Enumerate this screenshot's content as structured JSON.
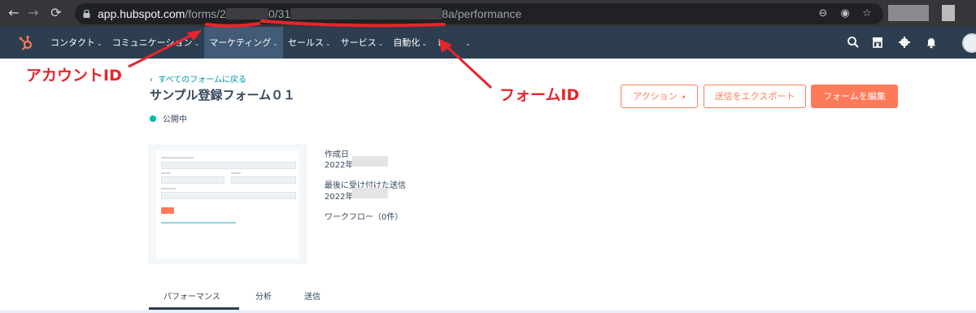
{
  "browser": {
    "url_host": "app.hubspot.com",
    "url_path_1": "/forms/2",
    "url_path_2": "0/31",
    "url_path_3": "8a/performance"
  },
  "nav": {
    "items": [
      {
        "label": "コンタクト"
      },
      {
        "label": "コミュニケーション"
      },
      {
        "label": "マーケティング"
      },
      {
        "label": "セールス"
      },
      {
        "label": "サービス"
      },
      {
        "label": "自動化"
      },
      {
        "label": "レ"
      }
    ]
  },
  "page": {
    "back_link": "すべてのフォームに戻る",
    "title": "サンプル登録フォーム０１",
    "status": "公開中",
    "actions_button": "アクション",
    "export_button": "送信をエクスポート",
    "edit_button": "フォームを編集"
  },
  "meta": {
    "created_label": "作成日",
    "created_value": "2022年",
    "last_submission_label": "最後に受け付けた送信",
    "last_submission_value": "2022年",
    "workflow_label": "ワークフロー（0件）"
  },
  "tabs": [
    "パフォーマンス",
    "分析",
    "送信"
  ],
  "annotations": {
    "account_id": "アカウントID",
    "form_id": "フォームID"
  },
  "colors": {
    "accent": "#ff7a59",
    "nav_bg": "#2d3e50",
    "annotation": "#e8252b",
    "status": "#00bda5"
  }
}
